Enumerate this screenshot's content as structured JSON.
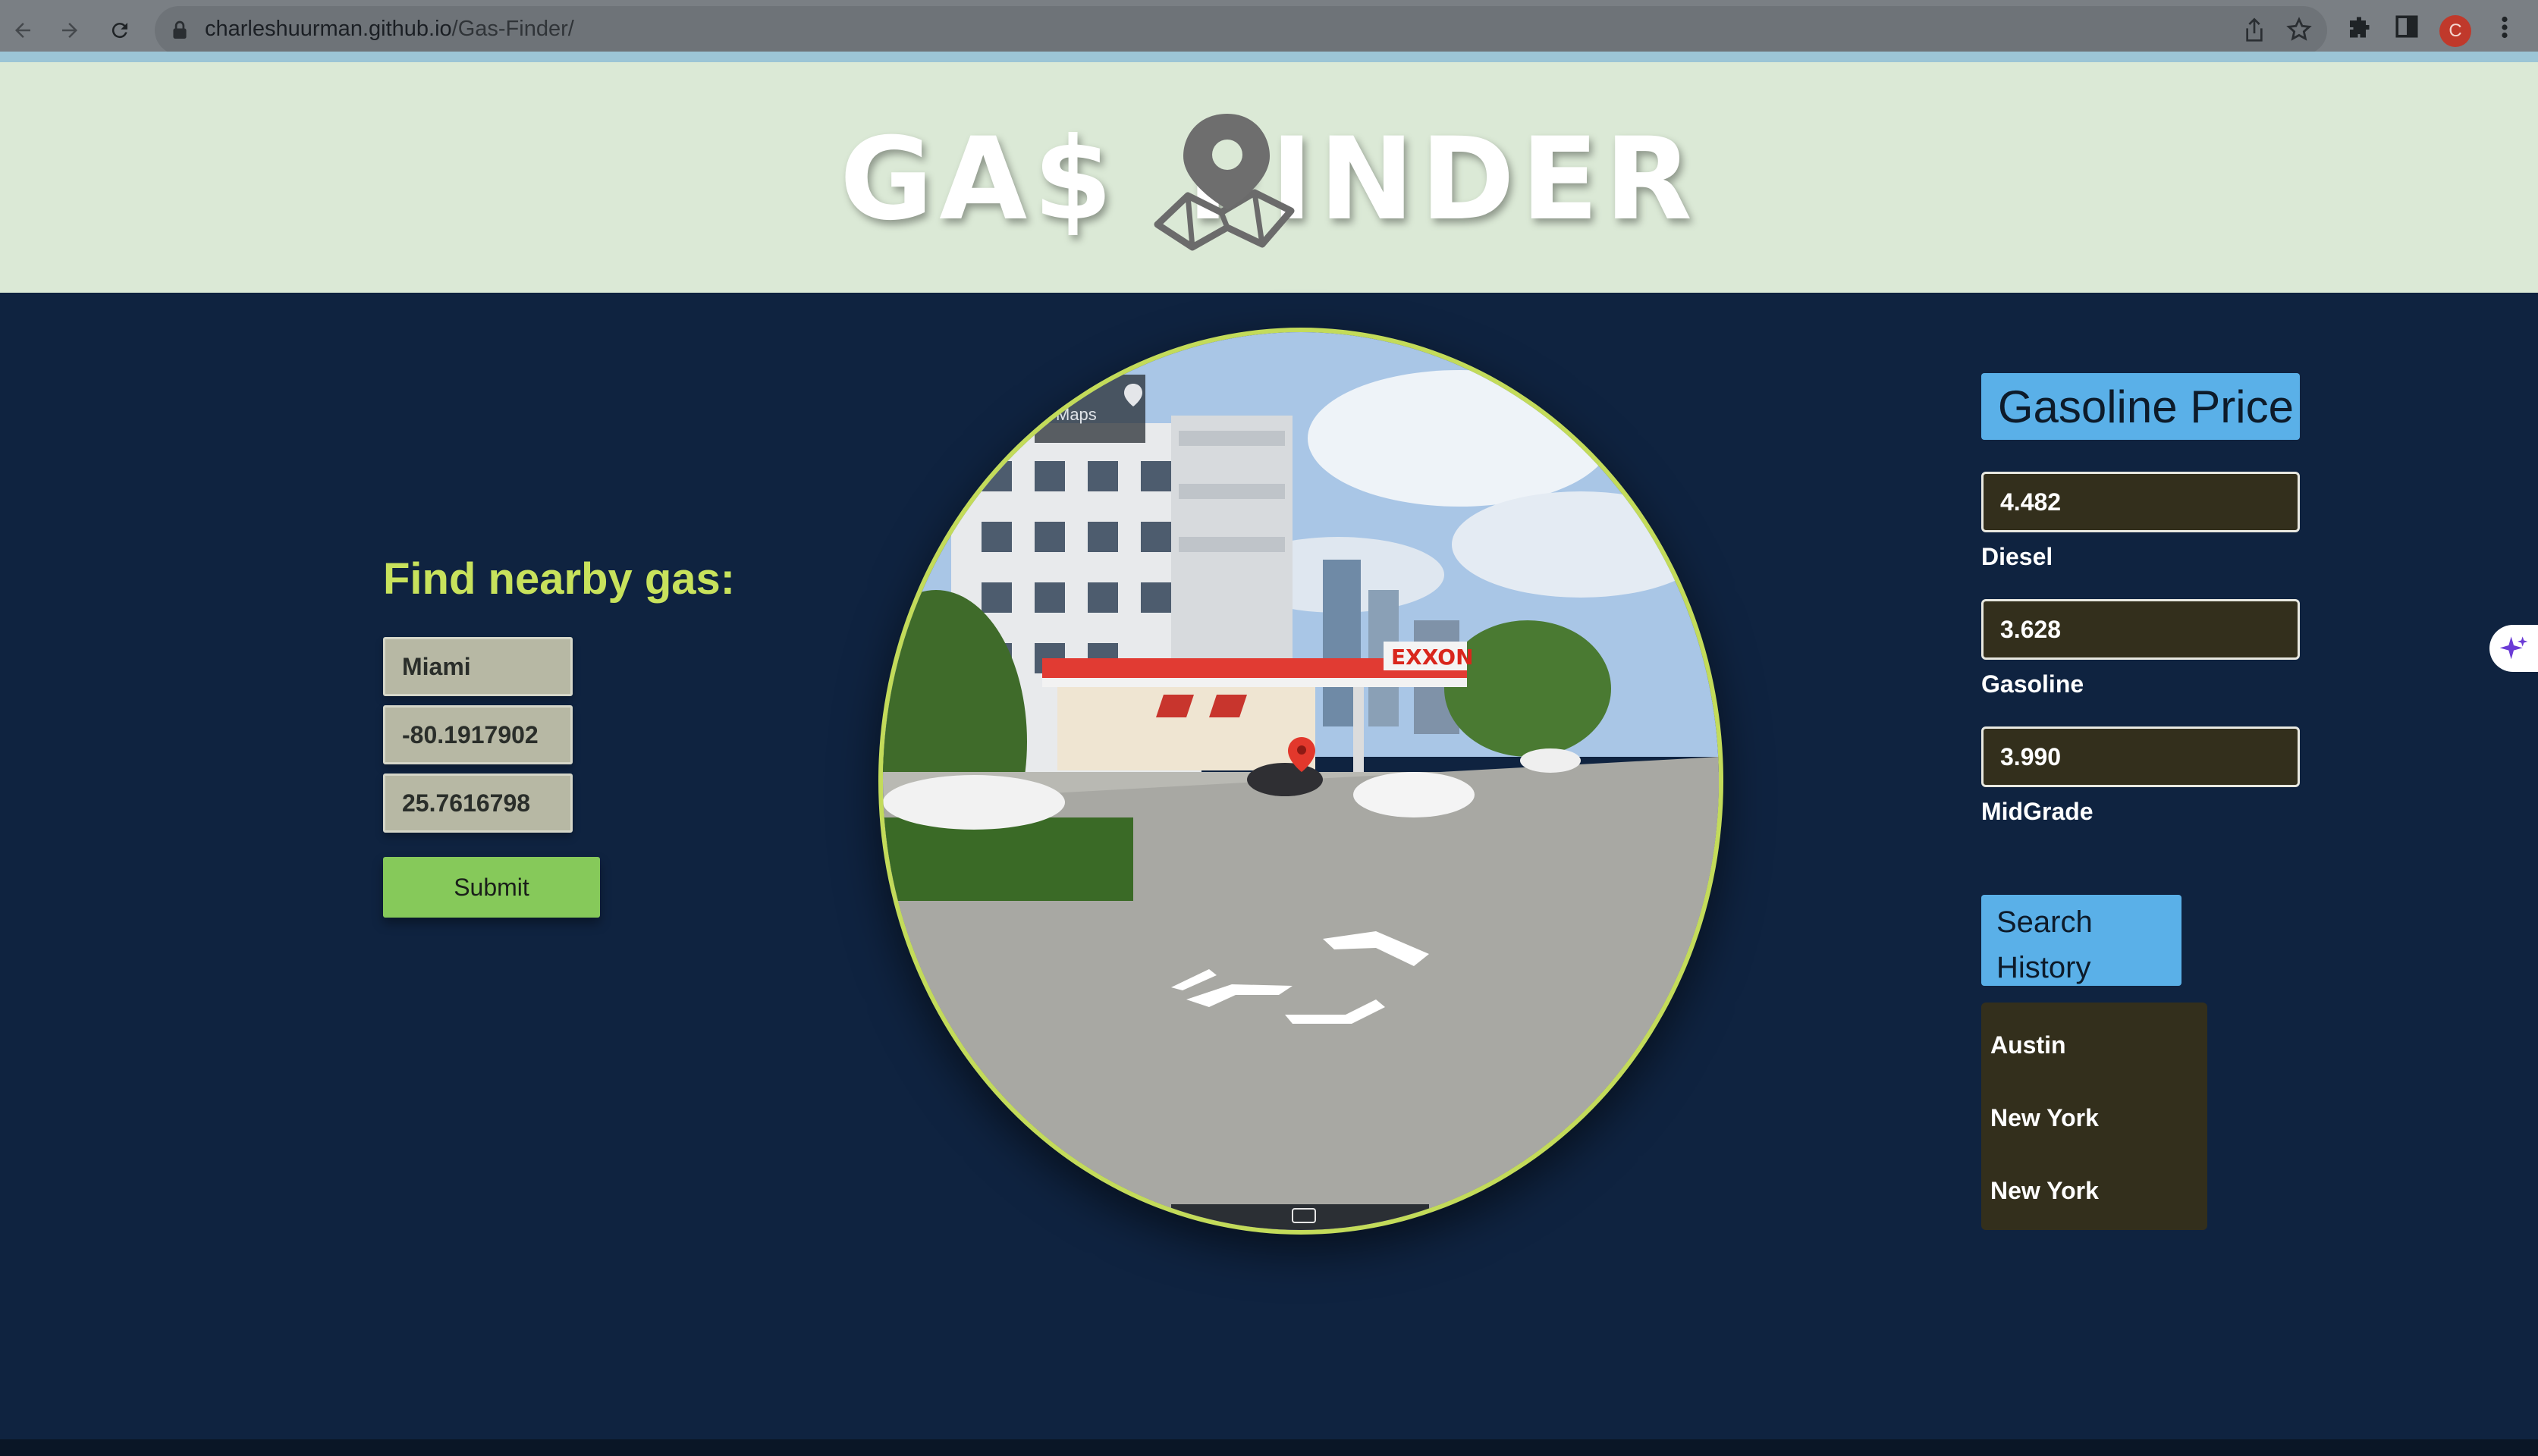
{
  "browser": {
    "url_host": "charleshuurman.github.io",
    "url_path": "/Gas-Finder/",
    "profile_initial": "C"
  },
  "header": {
    "logo_left": "GA$",
    "logo_right": "FINDER"
  },
  "search_form": {
    "title": "Find nearby gas:",
    "city_value": "Miami",
    "longitude_value": "-80.1917902",
    "latitude_value": "25.7616798",
    "submit_label": "Submit"
  },
  "street_view": {
    "maps_label": "Maps",
    "station_sign": "EXXON"
  },
  "prices": {
    "header": "Gasoline Price",
    "items": [
      {
        "value": "4.482",
        "label": "Diesel"
      },
      {
        "value": "3.628",
        "label": "Gasoline"
      },
      {
        "value": "3.990",
        "label": "MidGrade"
      }
    ]
  },
  "history": {
    "button_label": "Search History",
    "items": [
      "Austin",
      "New York",
      "New York"
    ]
  },
  "colors": {
    "page_bg": "#0f2340",
    "header_bg": "#dbe9d6",
    "accent_green": "#c8e25c",
    "submit_green": "#86c95a",
    "blue_button": "#5ab0e8",
    "dark_box": "#332f1c"
  },
  "icons": [
    "back-icon",
    "forward-icon",
    "reload-icon",
    "lock-icon",
    "share-icon",
    "star-icon",
    "extensions-icon",
    "sidebar-icon",
    "menu-icon",
    "map-pin-icon",
    "keyboard-icon",
    "sparkle-icon"
  ]
}
